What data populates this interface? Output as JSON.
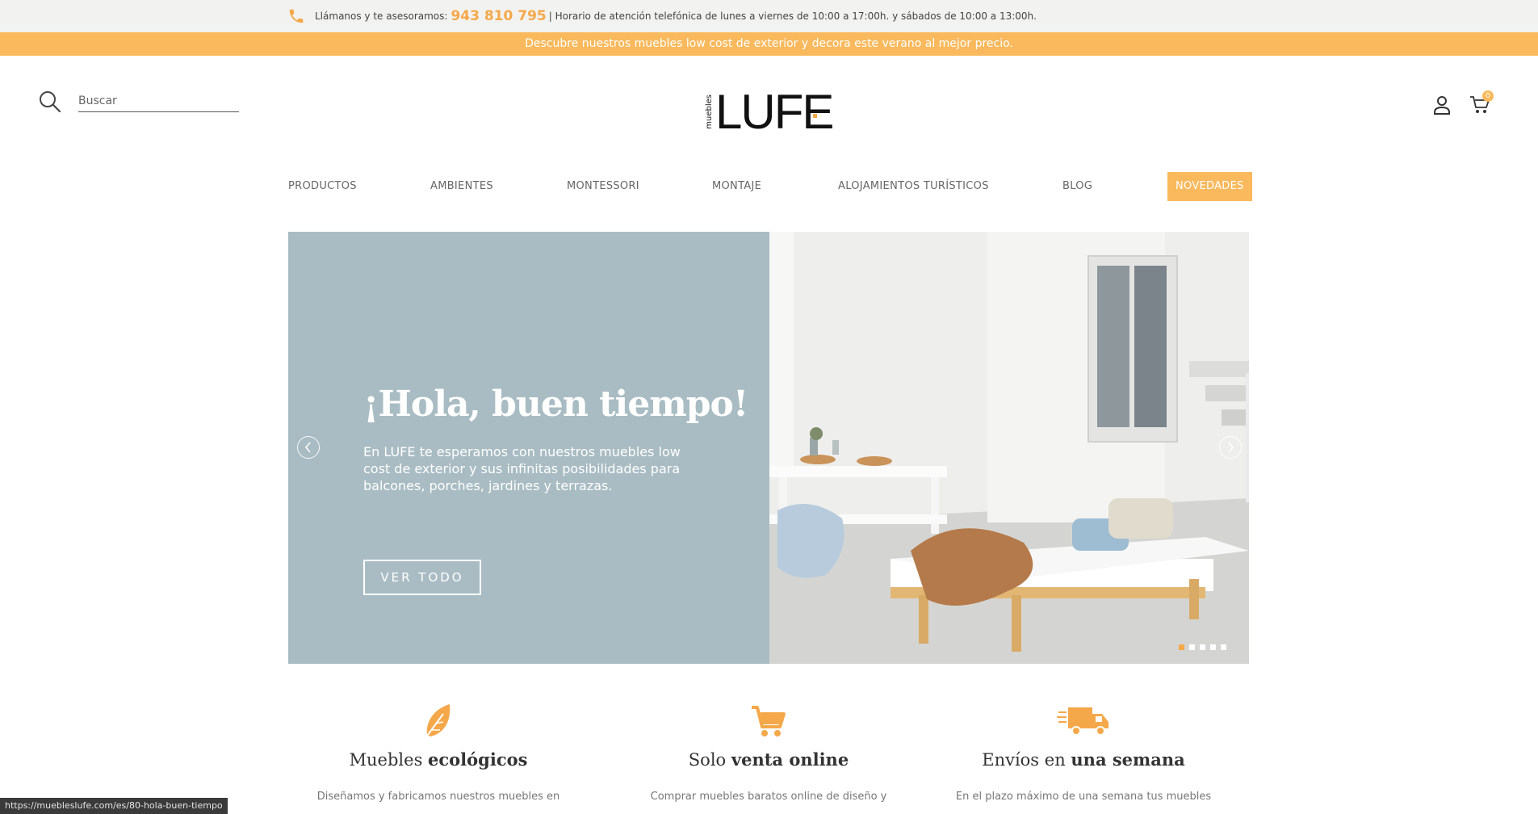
{
  "topbar": {
    "call_label": "Llámanos y te asesoramos:",
    "phone": "943 810 795",
    "hours": "| Horario de atención telefónica de lunes a viernes de 10:00 a 17:00h. y sábados de 10:00 a 13:00h."
  },
  "promo": {
    "text": "Descubre nuestros muebles low cost de exterior y decora este verano al mejor precio."
  },
  "search": {
    "placeholder": "Buscar"
  },
  "logo": {
    "small": "muebles",
    "main": "LUFE"
  },
  "cart": {
    "count": "0"
  },
  "nav": {
    "items": [
      {
        "label": "PRODUCTOS"
      },
      {
        "label": "AMBIENTES"
      },
      {
        "label": "MONTESSORI"
      },
      {
        "label": "MONTAJE"
      },
      {
        "label": "ALOJAMIENTOS TURÍSTICOS"
      },
      {
        "label": "BLOG"
      },
      {
        "label": "NOVEDADES"
      }
    ]
  },
  "hero": {
    "title": "¡Hola, buen tiempo!",
    "text": "En LUFE te esperamos con nuestros muebles low cost de exterior y sus infinitas posibilidades para balcones, porches, jardines y terrazas.",
    "button": "VER TODO",
    "slides": 5,
    "active_slide": 1
  },
  "features": [
    {
      "title_light": "Muebles ",
      "title_bold": "ecológicos",
      "text": "Diseñamos y fabricamos nuestros muebles en",
      "icon": "leaf-icon"
    },
    {
      "title_light": "Solo ",
      "title_bold": "venta online",
      "text": "Comprar muebles baratos online de diseño y",
      "icon": "cart-icon"
    },
    {
      "title_light": "Envíos en ",
      "title_bold": "una semana",
      "text": "En el plazo máximo de una semana tus muebles",
      "icon": "truck-icon"
    }
  ],
  "status_bar": {
    "url": "https://muebleslufe.com/es/80-hola-buen-tiempo"
  },
  "colors": {
    "accent": "#f9b95c",
    "hero_bg": "#a9bcc3",
    "topbar_bg": "#f2f2f0"
  }
}
